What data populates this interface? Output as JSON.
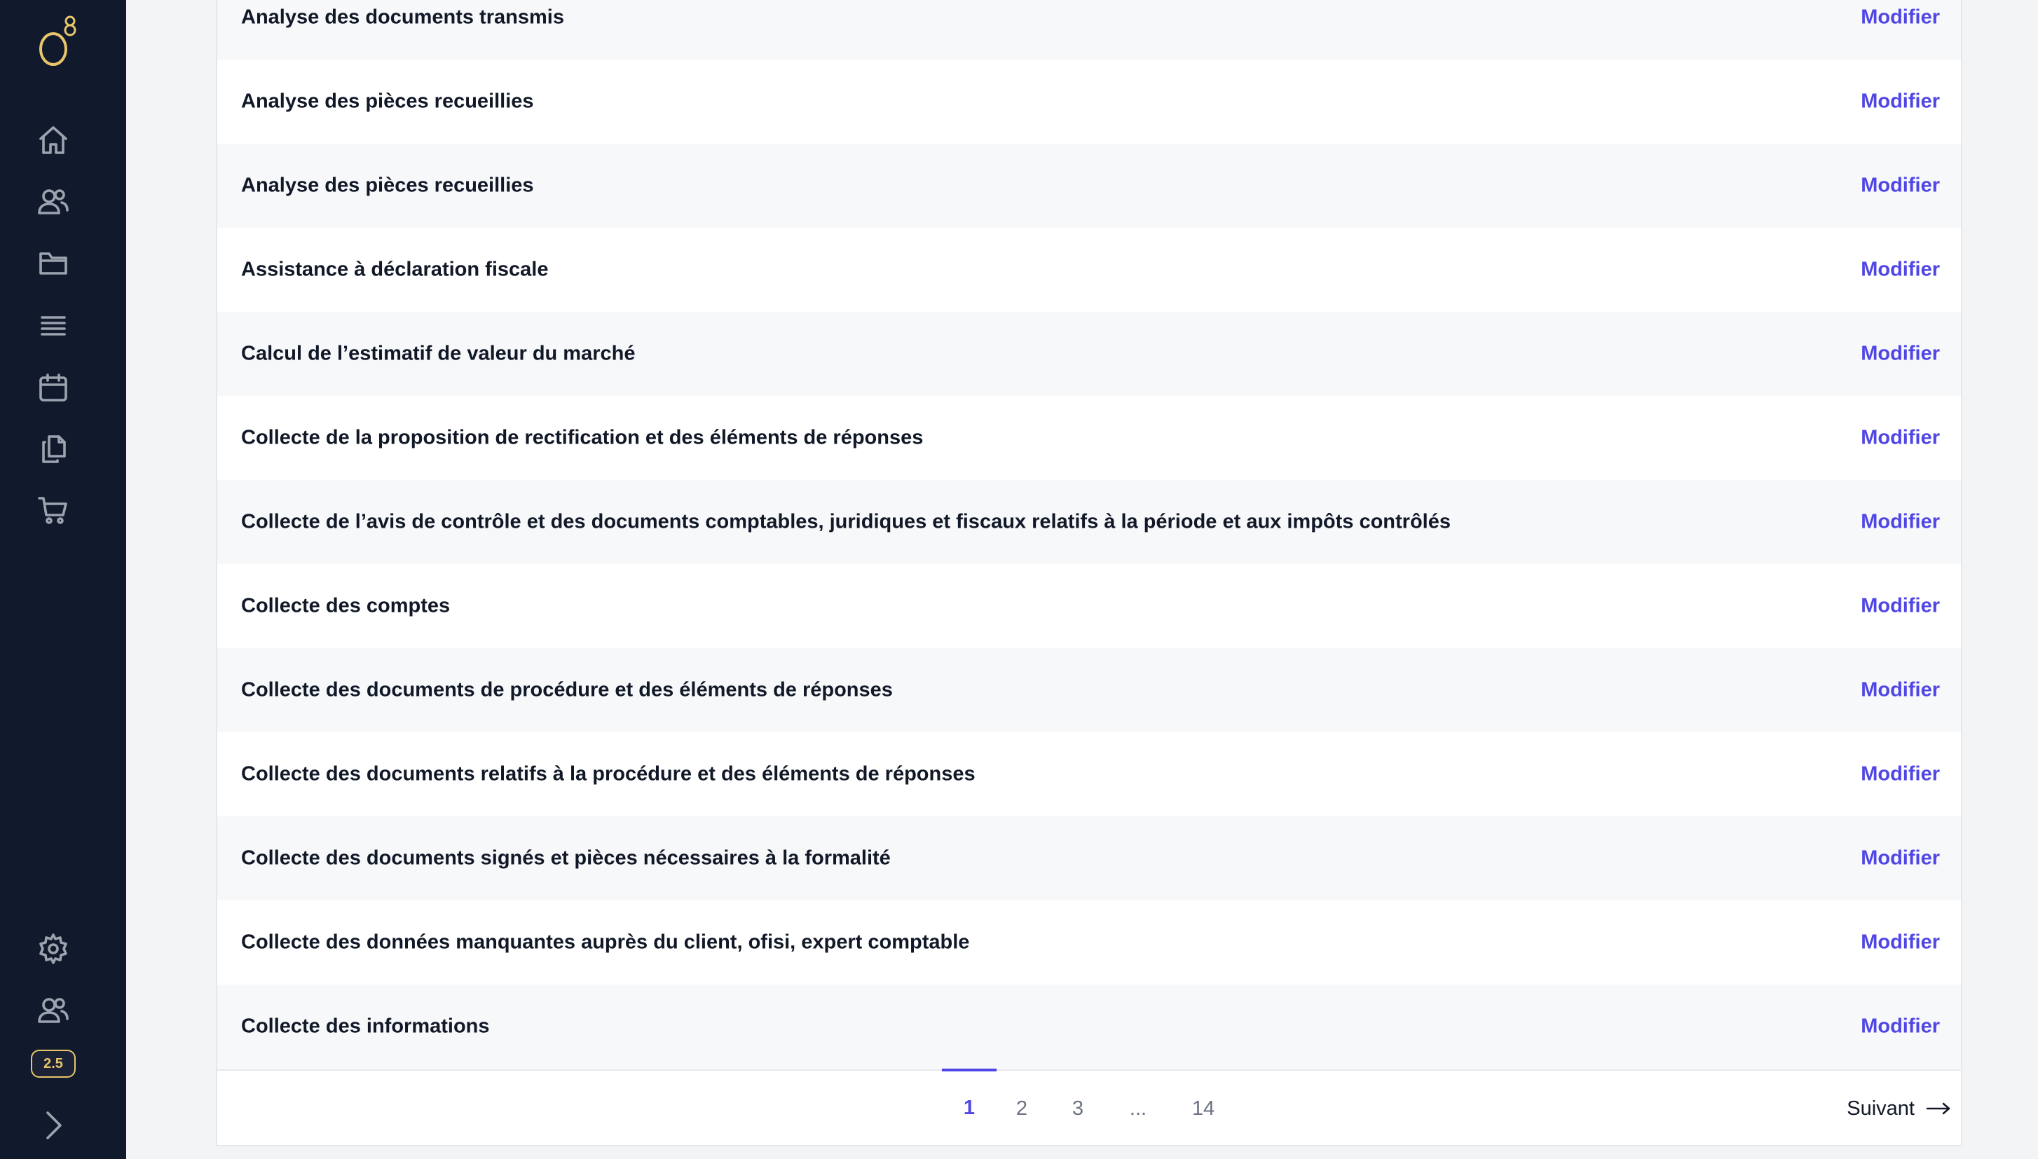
{
  "sidebar": {
    "logo_text": "o8",
    "nav": [
      {
        "icon": "home-icon"
      },
      {
        "icon": "users-icon"
      },
      {
        "icon": "folder-icon"
      },
      {
        "icon": "list-icon"
      },
      {
        "icon": "calendar-icon"
      },
      {
        "icon": "documents-icon"
      },
      {
        "icon": "cart-icon"
      }
    ],
    "bottom": [
      {
        "icon": "settings-icon"
      },
      {
        "icon": "team-icon"
      }
    ],
    "version": "2.5",
    "expand_icon": "chevron-right-icon"
  },
  "tasks": [
    {
      "name": "Analyse des documents transmis",
      "action": "Modifier"
    },
    {
      "name": "Analyse des pièces recueillies",
      "action": "Modifier"
    },
    {
      "name": "Analyse des pièces recueillies",
      "action": "Modifier"
    },
    {
      "name": "Assistance à déclaration fiscale",
      "action": "Modifier"
    },
    {
      "name": "Calcul de l’estimatif de valeur du marché",
      "action": "Modifier"
    },
    {
      "name": "Collecte de la proposition de rectification et des éléments de réponses",
      "action": "Modifier"
    },
    {
      "name": "Collecte de l’avis de contrôle et des documents comptables, juridiques et fiscaux relatifs à la période et aux impôts contrôlés",
      "action": "Modifier"
    },
    {
      "name": "Collecte des comptes",
      "action": "Modifier"
    },
    {
      "name": "Collecte des documents de procédure et des éléments de réponses",
      "action": "Modifier"
    },
    {
      "name": "Collecte des documents relatifs à la procédure et des éléments de réponses",
      "action": "Modifier"
    },
    {
      "name": "Collecte des documents signés et pièces nécessaires à la formalité",
      "action": "Modifier"
    },
    {
      "name": "Collecte des données manquantes auprès du client, ofisi, expert comptable",
      "action": "Modifier"
    },
    {
      "name": "Collecte des informations",
      "action": "Modifier"
    }
  ],
  "pagination": {
    "pages": [
      "1",
      "2",
      "3",
      "...",
      "14"
    ],
    "current": "1",
    "next_label": "Suivant"
  },
  "colors": {
    "sidebar_bg": "#111a2d",
    "accent": "#4f46e5",
    "logo_gold": "#e8c56a",
    "row_stripe": "#f7f8fa"
  }
}
